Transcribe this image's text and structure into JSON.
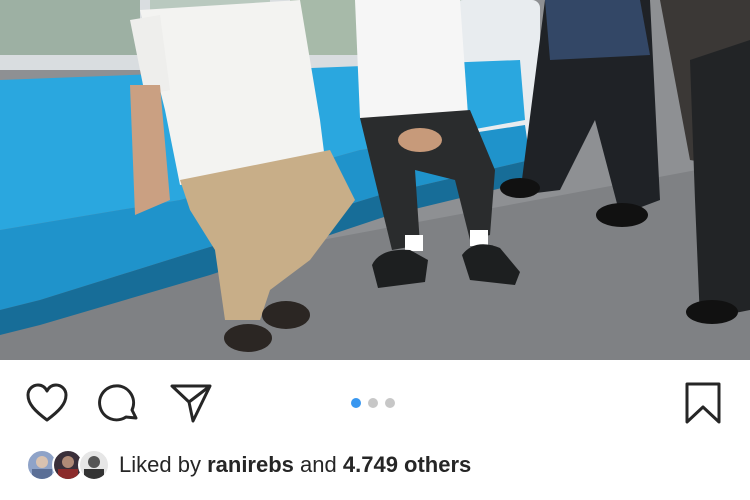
{
  "post": {
    "image_alt": "Two men seated on a blue bench in a train car",
    "carousel": {
      "count": 3,
      "active_index": 0
    }
  },
  "actions": {
    "like_icon": "heart-icon",
    "comment_icon": "comment-icon",
    "share_icon": "send-icon",
    "save_icon": "bookmark-icon"
  },
  "likes": {
    "prefix": "Liked by",
    "user": "ranirebs",
    "conjunction": "and",
    "others": "4.749 others"
  },
  "colors": {
    "active_dot": "#3897f0",
    "inactive_dot": "#c7c7c7",
    "text": "#262626",
    "seat_blue": "#2aa7df"
  }
}
